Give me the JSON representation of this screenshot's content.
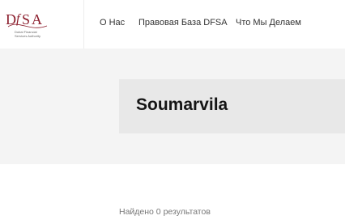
{
  "header": {
    "logo": {
      "mark": "DFSA",
      "tagline_lines": [
        "Dubai Financial",
        "Services Authority"
      ],
      "accent_color": "#8b1d2c"
    },
    "nav": [
      {
        "label": "О Нас"
      },
      {
        "label": "Правовая База DFSA"
      },
      {
        "label": "Что Мы Делаем"
      }
    ]
  },
  "hero": {
    "title": "Soumarvila"
  },
  "results": {
    "text": "Найдено 0 результатов"
  }
}
